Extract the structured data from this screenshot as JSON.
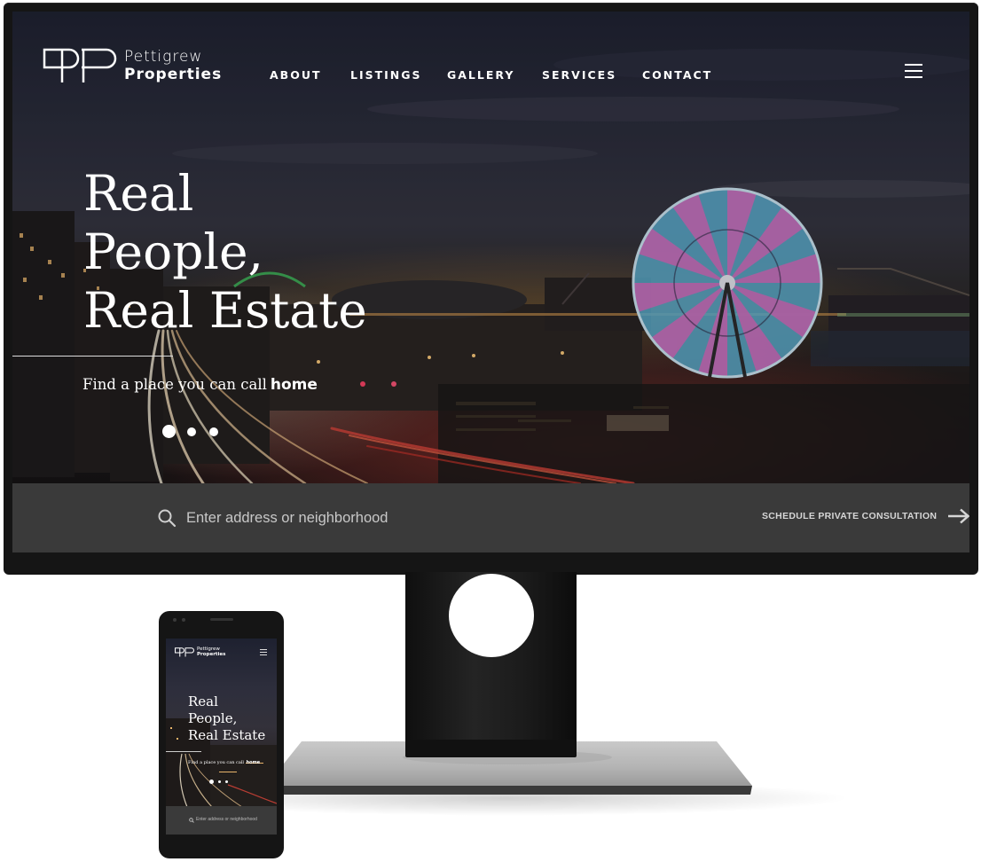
{
  "brand": {
    "line1": "Pettigrew",
    "line2": "Properties"
  },
  "nav": {
    "items": [
      {
        "label": "ABOUT"
      },
      {
        "label": "LISTINGS"
      },
      {
        "label": "GALLERY"
      },
      {
        "label": "SERVICES"
      },
      {
        "label": "CONTACT"
      }
    ],
    "menu_icon": "hamburger-icon"
  },
  "hero": {
    "headline": [
      "Real",
      "People,",
      "Real Estate"
    ],
    "tagline_prefix": "Find a place you can call",
    "tagline_emphasis": "home",
    "slides": {
      "count": 3,
      "active": 1
    }
  },
  "search": {
    "placeholder": "Enter address or neighborhood",
    "value": "",
    "icon": "search-icon"
  },
  "cta": {
    "label": "SCHEDULE PRIVATE CONSULTATION",
    "icon": "arrow-right-icon"
  },
  "phone": {
    "brand_line1": "Pettigrew",
    "brand_line2": "Properties",
    "headline": [
      "Real",
      "People,",
      "Real Estate"
    ],
    "tagline_prefix": "Find a place you can call",
    "tagline_emphasis": "home",
    "search_placeholder": "Enter address or neighborhood"
  },
  "colors": {
    "search_bar": "#3a3a3a",
    "device_frame": "#151515",
    "text": "#ffffff"
  }
}
